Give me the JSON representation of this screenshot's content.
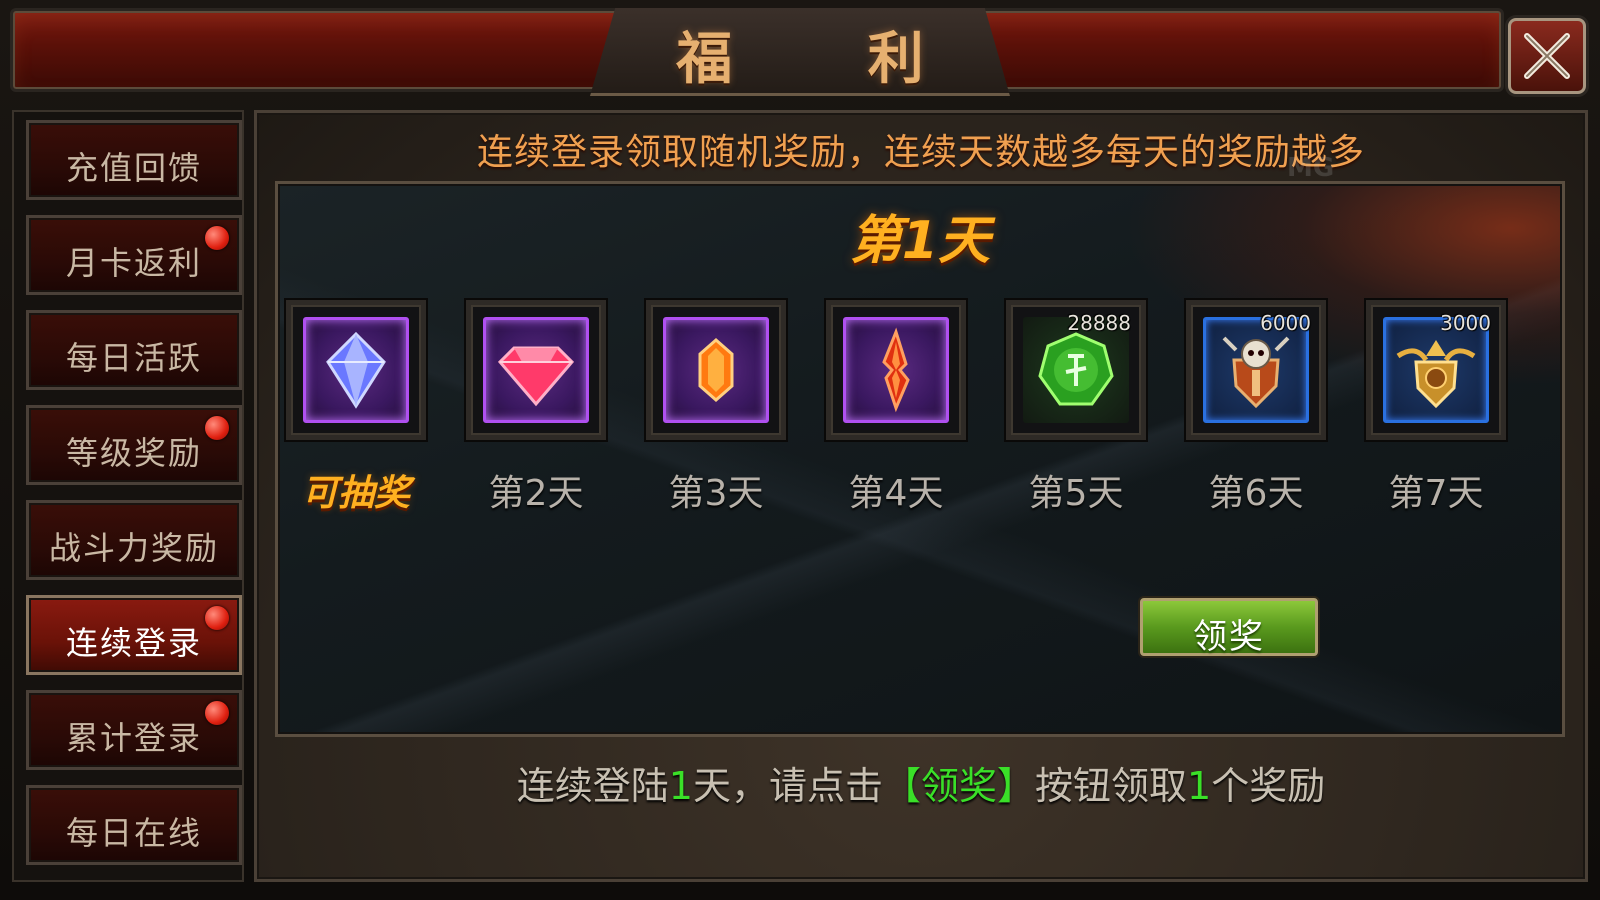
{
  "window": {
    "title": "福 利",
    "close_icon": "close-x-icon"
  },
  "sidebar": {
    "items": [
      {
        "label": "充值回馈",
        "badge": false,
        "active": false
      },
      {
        "label": "月卡返利",
        "badge": true,
        "active": false
      },
      {
        "label": "每日活跃",
        "badge": false,
        "active": false
      },
      {
        "label": "等级奖励",
        "badge": true,
        "active": false
      },
      {
        "label": "战斗力奖励",
        "badge": false,
        "active": false
      },
      {
        "label": "连续登录",
        "badge": true,
        "active": true
      },
      {
        "label": "累计登录",
        "badge": true,
        "active": false
      },
      {
        "label": "每日在线",
        "badge": false,
        "active": false
      }
    ]
  },
  "main": {
    "headline": "连续登录领取随机奖励，连续天数越多每天的奖励越多",
    "watermark": "MG",
    "current_day_title": "第1天",
    "rewards": [
      {
        "icon": "blue-crystal-icon",
        "count": "",
        "label": "可抽奖",
        "frame": "purple"
      },
      {
        "icon": "pink-gem-icon",
        "count": "",
        "label": "第2天",
        "frame": "purple"
      },
      {
        "icon": "orange-crystal-icon",
        "count": "",
        "label": "第3天",
        "frame": "purple"
      },
      {
        "icon": "red-shard-icon",
        "count": "",
        "label": "第4天",
        "frame": "purple"
      },
      {
        "icon": "green-rune-orb-icon",
        "count": "28888",
        "label": "第5天",
        "frame": "green"
      },
      {
        "icon": "skull-shield-emblem-icon",
        "count": "6000",
        "label": "第6天",
        "frame": "blue"
      },
      {
        "icon": "golden-winged-shield-icon",
        "count": "3000",
        "label": "第7天",
        "frame": "blue"
      }
    ],
    "claim_button": "领奖",
    "info": {
      "part1": "连续登陆",
      "days": "1",
      "part2": "天，请点击",
      "button_ref": "【领奖】",
      "part3": "按钮领取",
      "count": "1",
      "part4": "个奖励"
    }
  },
  "colors": {
    "title_gold": "#e6b070",
    "headline_orange": "#f0a050",
    "day_gold": "#ffb020",
    "highlight_green": "#3ae028",
    "active_tab_red": "#8a1a10",
    "claim_green": "#5a9a1e"
  }
}
